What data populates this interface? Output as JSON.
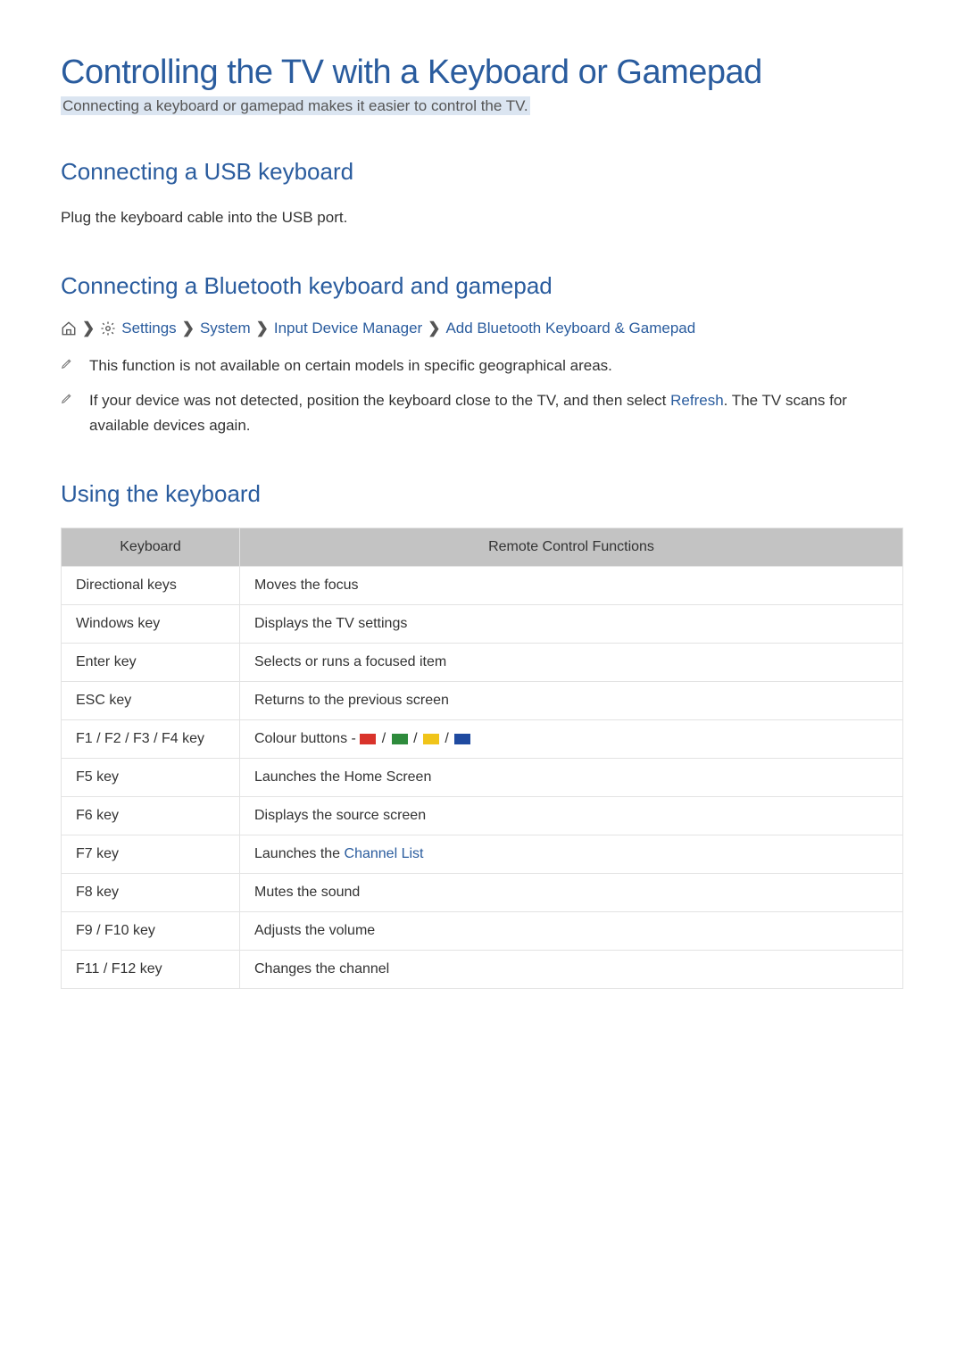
{
  "title": "Controlling the TV with a Keyboard or Gamepad",
  "subtitle": "Connecting a keyboard or gamepad makes it easier to control the TV.",
  "section_usb": {
    "heading": "Connecting a USB keyboard",
    "text": "Plug the keyboard cable into the USB port."
  },
  "section_bt": {
    "heading": "Connecting a Bluetooth keyboard and gamepad",
    "breadcrumb": {
      "settings": "Settings",
      "system": "System",
      "idm": "Input Device Manager",
      "add": "Add Bluetooth Keyboard & Gamepad"
    },
    "note1": "This function is not available on certain models in specific geographical areas.",
    "note2_pre": "If your device was not detected, position the keyboard close to the TV, and then select ",
    "note2_link": "Refresh",
    "note2_post": ". The TV scans for available devices again."
  },
  "section_using": {
    "heading": "Using the keyboard",
    "columns": {
      "keyboard": "Keyboard",
      "functions": "Remote Control Functions"
    },
    "rows": [
      {
        "k": "Directional keys",
        "f": "Moves the focus"
      },
      {
        "k": "Windows key",
        "f": "Displays the TV settings"
      },
      {
        "k": "Enter key",
        "f": "Selects or runs a focused item"
      },
      {
        "k": "ESC key",
        "f": "Returns to the previous screen"
      },
      {
        "k": "F1 / F2 / F3 / F4 key",
        "f_prefix": "Colour buttons - ",
        "colors": true
      },
      {
        "k": "F5 key",
        "f": "Launches the Home Screen"
      },
      {
        "k": "F6 key",
        "f": "Displays the source screen"
      },
      {
        "k": "F7 key",
        "f_prefix": "Launches the ",
        "link": "Channel List"
      },
      {
        "k": "F8 key",
        "f": "Mutes the sound"
      },
      {
        "k": "F9 / F10 key",
        "f": "Adjusts the volume"
      },
      {
        "k": "F11 / F12 key",
        "f": "Changes the channel"
      }
    ]
  }
}
